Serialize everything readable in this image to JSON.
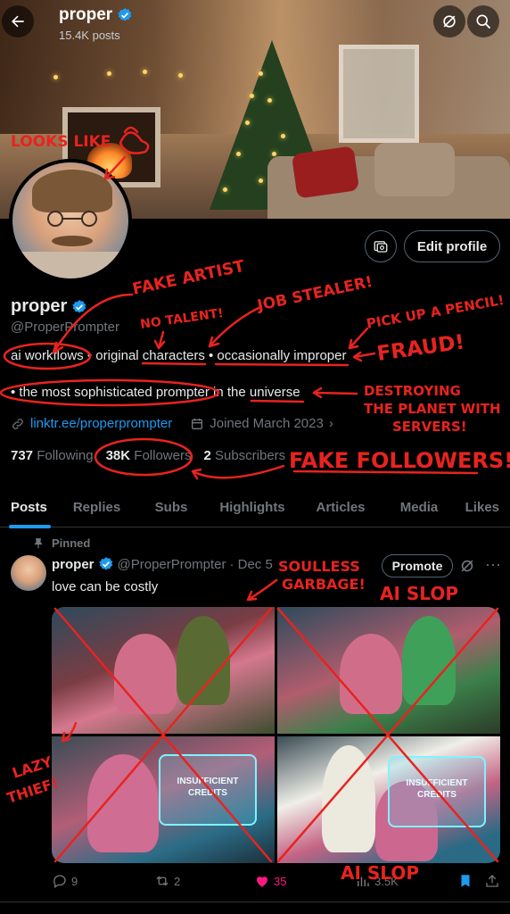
{
  "header": {
    "title": "proper",
    "post_count": "15.4K posts"
  },
  "profile": {
    "name": "proper",
    "handle": "@ProperPrompter",
    "bio_line1": "ai workflows • original characters • occasionally improper",
    "bio_line2": "• the most sophisticated prompter in the universe",
    "link": "linktr.ee/properprompter",
    "joined": "Joined March 2023",
    "following_count": "737",
    "following_label": "Following",
    "followers_count": "38K",
    "followers_label": "Followers",
    "subscribers_count": "2",
    "subscribers_label": "Subscribers",
    "edit_button": "Edit profile"
  },
  "tabs": [
    {
      "label": "Posts"
    },
    {
      "label": "Replies"
    },
    {
      "label": "Subs"
    },
    {
      "label": "Highlights"
    },
    {
      "label": "Articles"
    },
    {
      "label": "Media"
    },
    {
      "label": "Likes"
    }
  ],
  "post": {
    "pinned_label": "Pinned",
    "author": "proper",
    "handle": "@ProperPrompter",
    "date": "· Dec 5",
    "promote": "Promote",
    "text": "love can be costly",
    "panel3_text": "INSUFFICIENT CREDITS",
    "panel4_text": "INSUFFICIENT CREDITS",
    "replies": "9",
    "reposts": "2",
    "likes": "35",
    "views": "3.5K"
  },
  "annotations": {
    "looks_like": "LOOKS LIKE",
    "fake_artist": "FAKE ARTIST",
    "no_talent": "NO TALENT!",
    "job_stealer": "JOB STEALER!",
    "pick_up": "PICK UP A PENCIL!",
    "fraud": "FRAUD!",
    "destroying_1": "DESTROYING",
    "destroying_2": "THE PLANET WITH",
    "destroying_3": "SERVERS!",
    "fake_followers": "FAKE FOLLOWERS!",
    "soulless_1": "SOULLESS",
    "soulless_2": "GARBAGE!",
    "ai_slop_top": "AI SLOP",
    "lazy_1": "LAZY",
    "lazy_2": "THIEF!",
    "ai_slop_bottom": "AI SLOP"
  },
  "colors": {
    "accent": "#1d9bf0",
    "annotation_red": "#e8231f",
    "like_pink": "#f91880"
  }
}
